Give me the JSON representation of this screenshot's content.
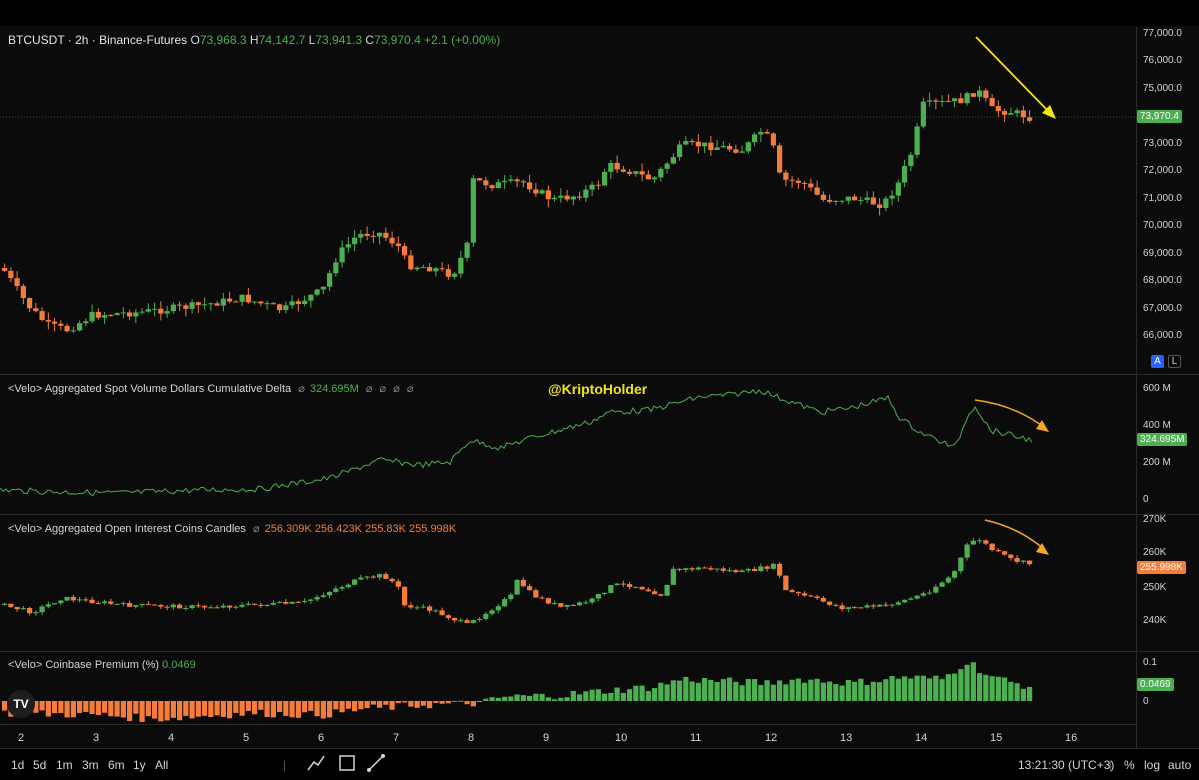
{
  "main": {
    "symbol": "BTCUSDT · 2h · Binance-Futures",
    "o": "O",
    "o_val": "73,968.3",
    "h": "H",
    "h_val": "74,142.7",
    "l": "L",
    "l_val": "73,941.3",
    "c": "C",
    "c_val": "73,970.4",
    "change": "+2.1 (+0.00%)",
    "price_badge": "73,970.4",
    "y_ticks": [
      "77,000.0",
      "76,000.0",
      "75,000.0",
      "73,000.0",
      "72,000.0",
      "71,000.0",
      "70,000.0",
      "69,000.0",
      "68,000.0",
      "67,000.0",
      "66,000.0"
    ],
    "toggle_a": "A",
    "toggle_l": "L"
  },
  "watermark": "@KriptoHolder",
  "cvd": {
    "title": "<Velo> Aggregated Spot Volume Dollars Cumulative Delta",
    "value": "324.695M",
    "badge": "324.695M",
    "y_ticks": [
      "600 M",
      "400 M",
      "200 M",
      "0"
    ]
  },
  "oi": {
    "title": "<Velo> Aggregated Open Interest Coins Candles",
    "o": "256.309K",
    "h": "256.423K",
    "l": "255.83K",
    "c": "255.998K",
    "badge": "255.998K",
    "y_ticks": [
      "270K",
      "260K",
      "250K",
      "240K"
    ]
  },
  "premium": {
    "title": "<Velo> Coinbase Premium (%)",
    "value": "0.0469",
    "badge": "0.0469",
    "y_ticks": [
      "0.1",
      "0"
    ]
  },
  "x_labels": [
    "2",
    "3",
    "4",
    "5",
    "6",
    "7",
    "8",
    "9",
    "10",
    "11",
    "12",
    "13",
    "14",
    "15",
    "16"
  ],
  "bottom": {
    "ranges": [
      "1d",
      "5d",
      "1m",
      "3m",
      "6m",
      "1y",
      "All"
    ],
    "time": "13:21:30 (UTC+3)",
    "pct": "%",
    "log": "log",
    "auto": "auto"
  },
  "colors": {
    "up": "#4caf50",
    "down": "#f57c3a",
    "arrow_yellow": "#f5e50a",
    "arrow_orange": "#f5a623"
  }
}
